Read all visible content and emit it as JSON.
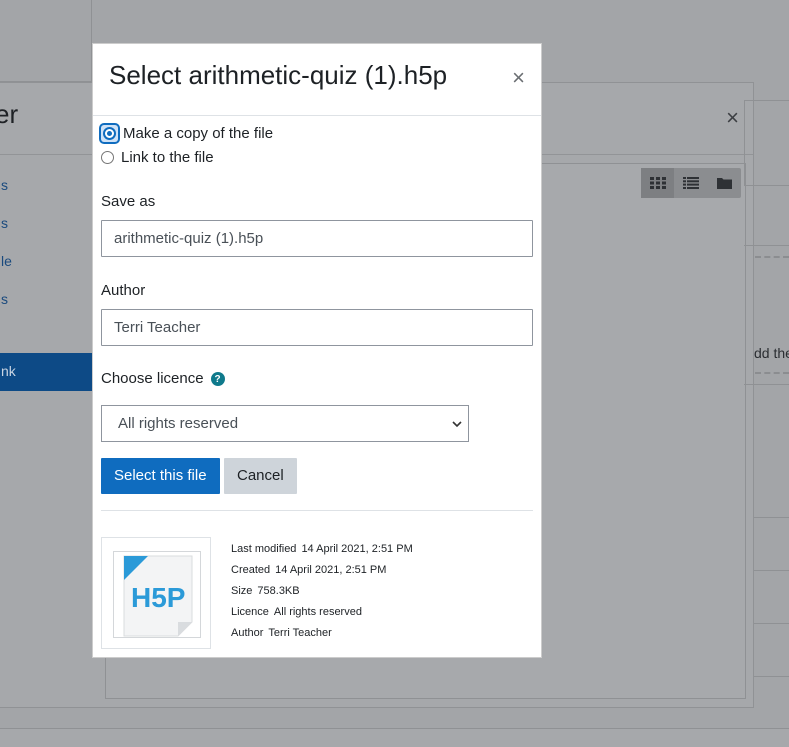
{
  "background": {
    "filepicker_title_partial": "er",
    "sidebar_items": [
      "s",
      "s",
      "le",
      "s"
    ],
    "sidebar_active": "nk",
    "right_text_partial": "dd the"
  },
  "dialog": {
    "title": "Select arithmetic-quiz (1).h5p",
    "close_symbol": "×",
    "options": [
      {
        "label": "Make a copy of the file",
        "checked": true
      },
      {
        "label": "Link to the file",
        "checked": false
      }
    ],
    "save_as": {
      "label": "Save as",
      "value": "arithmetic-quiz (1).h5p"
    },
    "author": {
      "label": "Author",
      "value": "Terri Teacher"
    },
    "licence": {
      "label": "Choose licence",
      "help_icon": "question-circle-icon",
      "selected": "All rights reserved"
    },
    "buttons": {
      "select": "Select this file",
      "cancel": "Cancel"
    },
    "file_info": {
      "last_modified": {
        "label": "Last modified",
        "value": "14 April 2021, 2:51 PM"
      },
      "created": {
        "label": "Created",
        "value": "14 April 2021, 2:51 PM"
      },
      "size": {
        "label": "Size",
        "value": "758.3KB"
      },
      "licence": {
        "label": "Licence",
        "value": "All rights reserved"
      },
      "author": {
        "label": "Author",
        "value": "Terri Teacher"
      }
    },
    "thumbnail_logo_text": "H5P"
  },
  "colors": {
    "primary": "#0f6cbf",
    "secondary_button": "#ced4da",
    "help_icon": "#0f7a8c"
  }
}
